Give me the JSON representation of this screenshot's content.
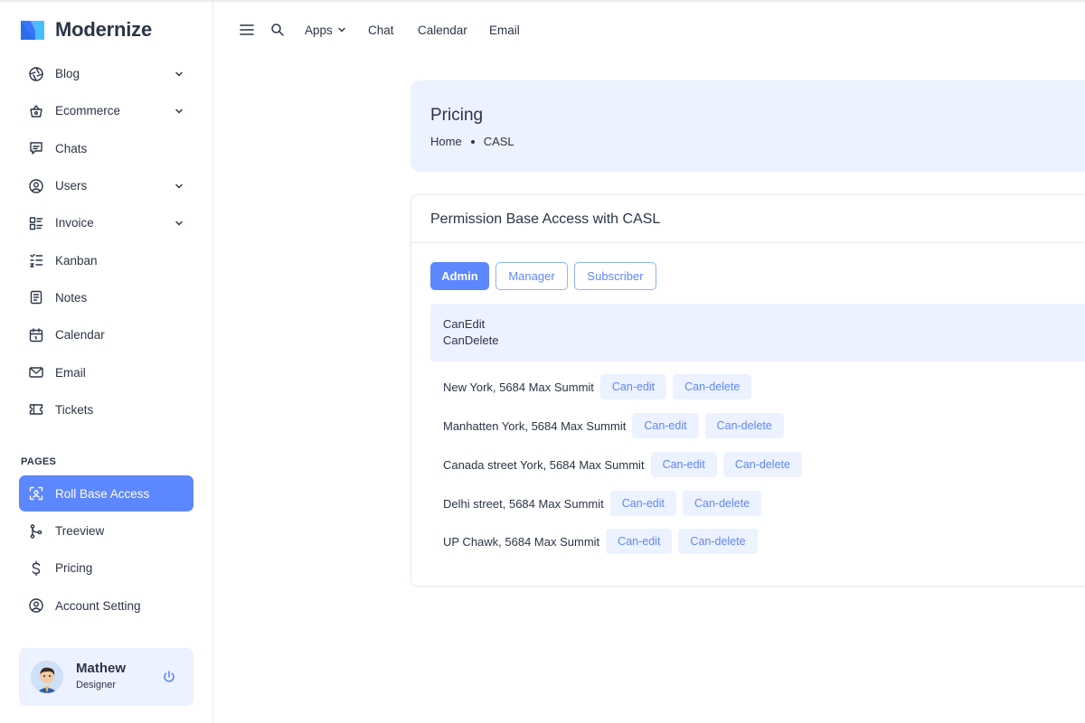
{
  "brand": {
    "name": "Modernize"
  },
  "colors": {
    "primary": "#5d87ff",
    "light_primary": "#ecf2ff",
    "text": "#2a3547",
    "border": "#e5eaef"
  },
  "sidebar": {
    "items": [
      {
        "label": "Blog",
        "icon": "aperture-icon",
        "has_chevron": true
      },
      {
        "label": "Ecommerce",
        "icon": "basket-icon",
        "has_chevron": true
      },
      {
        "label": "Chats",
        "icon": "message-icon",
        "has_chevron": false
      },
      {
        "label": "Users",
        "icon": "user-circle-icon",
        "has_chevron": true
      },
      {
        "label": "Invoice",
        "icon": "file-list-icon",
        "has_chevron": true
      },
      {
        "label": "Kanban",
        "icon": "checklist-icon",
        "has_chevron": false
      },
      {
        "label": "Notes",
        "icon": "notes-icon",
        "has_chevron": false
      },
      {
        "label": "Calendar",
        "icon": "calendar-icon",
        "has_chevron": false
      },
      {
        "label": "Email",
        "icon": "mail-icon",
        "has_chevron": false
      },
      {
        "label": "Tickets",
        "icon": "ticket-icon",
        "has_chevron": false
      }
    ],
    "section_label": "PAGES",
    "pages": [
      {
        "label": "Roll Base Access",
        "icon": "face-id-icon",
        "active": true
      },
      {
        "label": "Treeview",
        "icon": "git-merge-icon",
        "active": false
      },
      {
        "label": "Pricing",
        "icon": "dollar-icon",
        "active": false
      },
      {
        "label": "Account Setting",
        "icon": "user-circle-icon",
        "active": false
      }
    ],
    "profile": {
      "name": "Mathew",
      "role": "Designer"
    }
  },
  "header": {
    "menu": {
      "apps": "Apps",
      "chat": "Chat",
      "calendar": "Calendar",
      "email": "Email"
    }
  },
  "page_header": {
    "title": "Pricing",
    "breadcrumb": [
      "Home",
      "CASL"
    ]
  },
  "card": {
    "title": "Permission Base Access with CASL",
    "roles": [
      "Admin",
      "Manager",
      "Subscriber"
    ],
    "active_role": "Admin",
    "permissions": [
      "CanEdit",
      "CanDelete"
    ],
    "rows": [
      {
        "label": "New York, 5684 Max Summit",
        "edit": "Can-edit",
        "delete": "Can-delete"
      },
      {
        "label": "Manhatten York, 5684 Max Summit",
        "edit": "Can-edit",
        "delete": "Can-delete"
      },
      {
        "label": "Canada street York, 5684 Max Summit",
        "edit": "Can-edit",
        "delete": "Can-delete"
      },
      {
        "label": "Delhi street, 5684 Max Summit",
        "edit": "Can-edit",
        "delete": "Can-delete"
      },
      {
        "label": "UP Chawk, 5684 Max Summit",
        "edit": "Can-edit",
        "delete": "Can-delete"
      }
    ]
  }
}
